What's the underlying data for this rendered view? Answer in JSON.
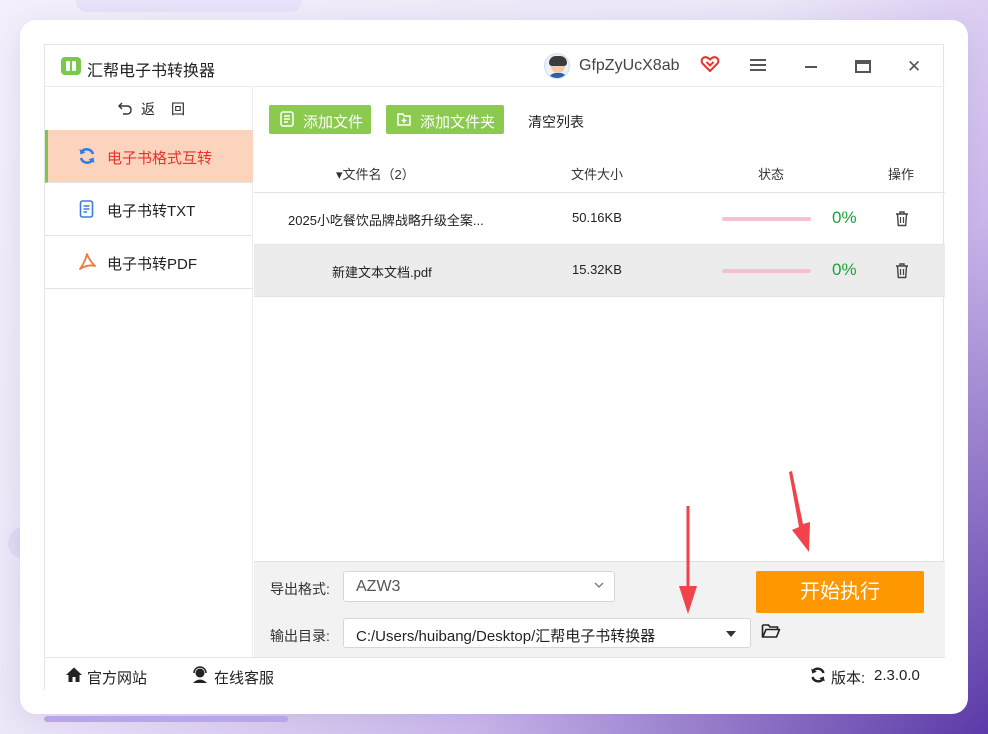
{
  "app": {
    "title": "汇帮电子书转换器",
    "username": "GfpZyUcX8ab"
  },
  "window_controls": {
    "menu": "menu-icon",
    "minimize": "minimize-icon",
    "maximize": "maximize-icon",
    "close_glyph": "✕"
  },
  "sidebar": {
    "back_label": "返回",
    "items": [
      {
        "label": "电子书格式互转",
        "icon": "refresh-icon",
        "active": true
      },
      {
        "label": "电子书转TXT",
        "icon": "document-icon",
        "active": false
      },
      {
        "label": "电子书转PDF",
        "icon": "pdf-icon",
        "active": false
      }
    ]
  },
  "toolbar": {
    "add_file": "添加文件",
    "add_folder": "添加文件夹",
    "clear_list": "清空列表"
  },
  "table": {
    "headers": {
      "name": "▾文件名（2）",
      "size": "文件大小",
      "status": "状态",
      "action": "操作"
    },
    "rows": [
      {
        "name": "2025小吃餐饮品牌战略升级全案...",
        "size": "50.16KB",
        "progress": 0,
        "status": "0%"
      },
      {
        "name": "新建文本文档.pdf",
        "size": "15.32KB",
        "progress": 0,
        "status": "0%"
      }
    ]
  },
  "bottom": {
    "format_label": "导出格式:",
    "format_value": "AZW3",
    "output_label": "输出目录:",
    "output_value": "C:/Users/huibang/Desktop/汇帮电子书转换器",
    "start_button": "开始执行"
  },
  "statusbar": {
    "website": "官方网站",
    "support": "在线客服",
    "version_label": "版本:",
    "version_value": "2.3.0.0"
  },
  "colors": {
    "accent_green": "#8cc94f",
    "active_bg": "#fcd4bd",
    "active_text": "#e8322b",
    "start_orange": "#ff9800",
    "percent_green": "#1aa33a",
    "arrow_red": "#f0434a"
  }
}
